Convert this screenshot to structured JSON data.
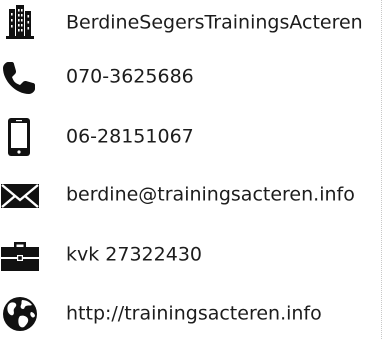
{
  "contact": {
    "company": {
      "text": "BerdineSegersTrainingsActeren",
      "icon": "building-icon"
    },
    "phone": {
      "text": "070-3625686",
      "icon": "phone-icon"
    },
    "mobile": {
      "text": "06-28151067",
      "icon": "mobile-icon"
    },
    "email": {
      "text": "berdine@trainingsacteren.info",
      "icon": "envelope-icon"
    },
    "kvk": {
      "text": "kvk 27322430",
      "icon": "briefcase-icon"
    },
    "website": {
      "text": "http://trainingsacteren.info",
      "icon": "globe-icon"
    }
  },
  "colors": {
    "icon": "#111111",
    "text": "#1c1c1c",
    "divider": "#c8c8c8"
  }
}
